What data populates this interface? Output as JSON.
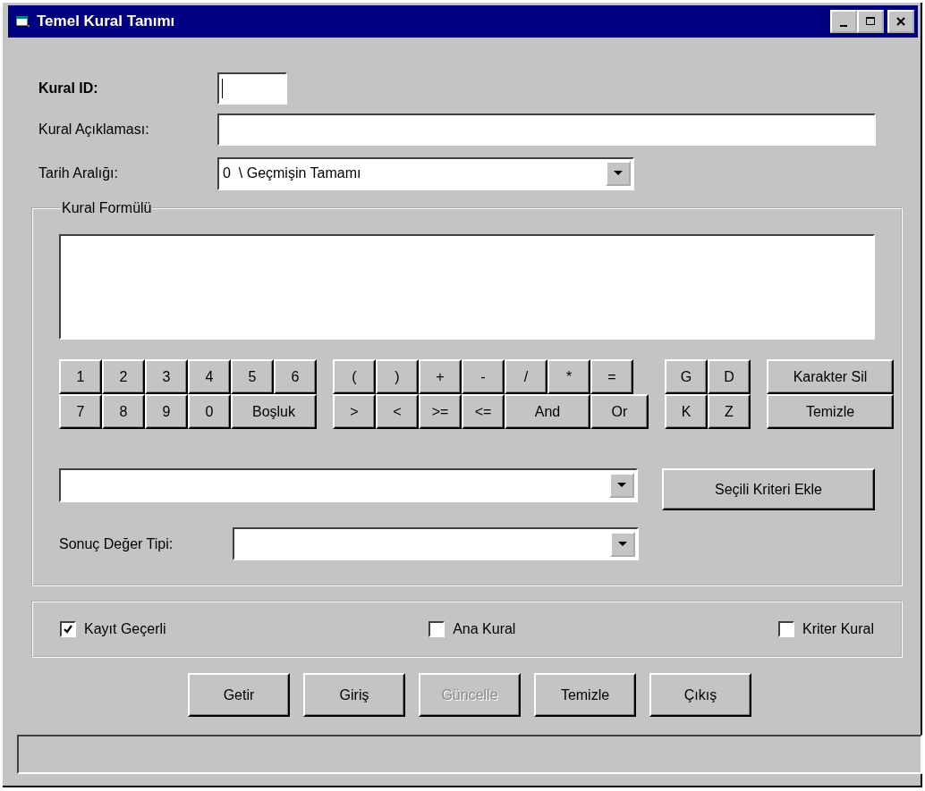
{
  "window": {
    "title": "Temel Kural Tanımı"
  },
  "fields": {
    "rule_id": {
      "label": "Kural ID:"
    },
    "description": {
      "label": "Kural Açıklaması:"
    },
    "date_range": {
      "label": "Tarih Aralığı:",
      "value": "0  \\ Geçmişin Tamamı"
    }
  },
  "formula_group": {
    "title": "Kural Formülü",
    "keypad": [
      {
        "rows": [
          [
            {
              "label": "1",
              "kind": "normal"
            },
            {
              "label": "2",
              "kind": "normal"
            },
            {
              "label": "3",
              "kind": "normal"
            },
            {
              "label": "4",
              "kind": "normal"
            },
            {
              "label": "5",
              "kind": "normal"
            },
            {
              "label": "6",
              "kind": "normal"
            }
          ],
          [
            {
              "label": "7",
              "kind": "normal"
            },
            {
              "label": "8",
              "kind": "normal"
            },
            {
              "label": "9",
              "kind": "normal"
            },
            {
              "label": "0",
              "kind": "normal"
            },
            {
              "label": "Boşluk",
              "kind": "wide"
            }
          ]
        ]
      },
      {
        "rows": [
          [
            {
              "label": "(",
              "kind": "normal"
            },
            {
              "label": ")",
              "kind": "normal"
            },
            {
              "label": "+",
              "kind": "normal"
            },
            {
              "label": "-",
              "kind": "normal"
            },
            {
              "label": "/",
              "kind": "normal"
            },
            {
              "label": "*",
              "kind": "normal"
            },
            {
              "label": "=",
              "kind": "normal"
            }
          ],
          [
            {
              "label": ">",
              "kind": "normal"
            },
            {
              "label": "<",
              "kind": "normal"
            },
            {
              "label": ">=",
              "kind": "normal"
            },
            {
              "label": "<=",
              "kind": "normal"
            },
            {
              "label": "And",
              "kind": "wide"
            },
            {
              "label": "Or",
              "kind": "mid"
            }
          ]
        ]
      },
      {
        "rows": [
          [
            {
              "label": "G",
              "kind": "normal"
            },
            {
              "label": "D",
              "kind": "normal"
            }
          ],
          [
            {
              "label": "K",
              "kind": "normal"
            },
            {
              "label": "Z",
              "kind": "normal"
            }
          ]
        ]
      },
      {
        "rows": [
          [
            {
              "label": "Karakter Sil",
              "kind": "action"
            }
          ],
          [
            {
              "label": "Temizle",
              "kind": "action"
            }
          ]
        ]
      }
    ],
    "add_criteria_button": "Seçili Kriteri Ekle",
    "result_type": {
      "label": "Sonuç Değer Tipi:"
    }
  },
  "checkboxes": [
    {
      "label": "Kayıt Geçerli",
      "checked": true
    },
    {
      "label": "Ana Kural",
      "checked": false
    },
    {
      "label": "Kriter Kural",
      "checked": false
    }
  ],
  "buttons": [
    {
      "label": "Getir",
      "disabled": false
    },
    {
      "label": "Giriş",
      "disabled": false
    },
    {
      "label": "Güncelle",
      "disabled": true
    },
    {
      "label": "Temizle",
      "disabled": false
    },
    {
      "label": "Çıkış",
      "disabled": false
    }
  ]
}
